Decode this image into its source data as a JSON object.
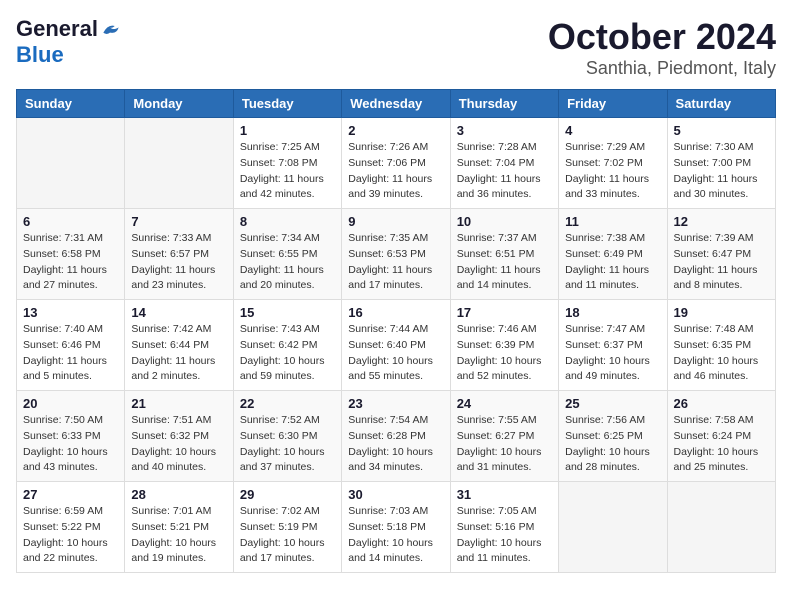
{
  "header": {
    "logo_general": "General",
    "logo_blue": "Blue",
    "month": "October 2024",
    "location": "Santhia, Piedmont, Italy"
  },
  "weekdays": [
    "Sunday",
    "Monday",
    "Tuesday",
    "Wednesday",
    "Thursday",
    "Friday",
    "Saturday"
  ],
  "weeks": [
    [
      {
        "day": "",
        "sunrise": "",
        "sunset": "",
        "daylight": ""
      },
      {
        "day": "",
        "sunrise": "",
        "sunset": "",
        "daylight": ""
      },
      {
        "day": "1",
        "sunrise": "Sunrise: 7:25 AM",
        "sunset": "Sunset: 7:08 PM",
        "daylight": "Daylight: 11 hours and 42 minutes."
      },
      {
        "day": "2",
        "sunrise": "Sunrise: 7:26 AM",
        "sunset": "Sunset: 7:06 PM",
        "daylight": "Daylight: 11 hours and 39 minutes."
      },
      {
        "day": "3",
        "sunrise": "Sunrise: 7:28 AM",
        "sunset": "Sunset: 7:04 PM",
        "daylight": "Daylight: 11 hours and 36 minutes."
      },
      {
        "day": "4",
        "sunrise": "Sunrise: 7:29 AM",
        "sunset": "Sunset: 7:02 PM",
        "daylight": "Daylight: 11 hours and 33 minutes."
      },
      {
        "day": "5",
        "sunrise": "Sunrise: 7:30 AM",
        "sunset": "Sunset: 7:00 PM",
        "daylight": "Daylight: 11 hours and 30 minutes."
      }
    ],
    [
      {
        "day": "6",
        "sunrise": "Sunrise: 7:31 AM",
        "sunset": "Sunset: 6:58 PM",
        "daylight": "Daylight: 11 hours and 27 minutes."
      },
      {
        "day": "7",
        "sunrise": "Sunrise: 7:33 AM",
        "sunset": "Sunset: 6:57 PM",
        "daylight": "Daylight: 11 hours and 23 minutes."
      },
      {
        "day": "8",
        "sunrise": "Sunrise: 7:34 AM",
        "sunset": "Sunset: 6:55 PM",
        "daylight": "Daylight: 11 hours and 20 minutes."
      },
      {
        "day": "9",
        "sunrise": "Sunrise: 7:35 AM",
        "sunset": "Sunset: 6:53 PM",
        "daylight": "Daylight: 11 hours and 17 minutes."
      },
      {
        "day": "10",
        "sunrise": "Sunrise: 7:37 AM",
        "sunset": "Sunset: 6:51 PM",
        "daylight": "Daylight: 11 hours and 14 minutes."
      },
      {
        "day": "11",
        "sunrise": "Sunrise: 7:38 AM",
        "sunset": "Sunset: 6:49 PM",
        "daylight": "Daylight: 11 hours and 11 minutes."
      },
      {
        "day": "12",
        "sunrise": "Sunrise: 7:39 AM",
        "sunset": "Sunset: 6:47 PM",
        "daylight": "Daylight: 11 hours and 8 minutes."
      }
    ],
    [
      {
        "day": "13",
        "sunrise": "Sunrise: 7:40 AM",
        "sunset": "Sunset: 6:46 PM",
        "daylight": "Daylight: 11 hours and 5 minutes."
      },
      {
        "day": "14",
        "sunrise": "Sunrise: 7:42 AM",
        "sunset": "Sunset: 6:44 PM",
        "daylight": "Daylight: 11 hours and 2 minutes."
      },
      {
        "day": "15",
        "sunrise": "Sunrise: 7:43 AM",
        "sunset": "Sunset: 6:42 PM",
        "daylight": "Daylight: 10 hours and 59 minutes."
      },
      {
        "day": "16",
        "sunrise": "Sunrise: 7:44 AM",
        "sunset": "Sunset: 6:40 PM",
        "daylight": "Daylight: 10 hours and 55 minutes."
      },
      {
        "day": "17",
        "sunrise": "Sunrise: 7:46 AM",
        "sunset": "Sunset: 6:39 PM",
        "daylight": "Daylight: 10 hours and 52 minutes."
      },
      {
        "day": "18",
        "sunrise": "Sunrise: 7:47 AM",
        "sunset": "Sunset: 6:37 PM",
        "daylight": "Daylight: 10 hours and 49 minutes."
      },
      {
        "day": "19",
        "sunrise": "Sunrise: 7:48 AM",
        "sunset": "Sunset: 6:35 PM",
        "daylight": "Daylight: 10 hours and 46 minutes."
      }
    ],
    [
      {
        "day": "20",
        "sunrise": "Sunrise: 7:50 AM",
        "sunset": "Sunset: 6:33 PM",
        "daylight": "Daylight: 10 hours and 43 minutes."
      },
      {
        "day": "21",
        "sunrise": "Sunrise: 7:51 AM",
        "sunset": "Sunset: 6:32 PM",
        "daylight": "Daylight: 10 hours and 40 minutes."
      },
      {
        "day": "22",
        "sunrise": "Sunrise: 7:52 AM",
        "sunset": "Sunset: 6:30 PM",
        "daylight": "Daylight: 10 hours and 37 minutes."
      },
      {
        "day": "23",
        "sunrise": "Sunrise: 7:54 AM",
        "sunset": "Sunset: 6:28 PM",
        "daylight": "Daylight: 10 hours and 34 minutes."
      },
      {
        "day": "24",
        "sunrise": "Sunrise: 7:55 AM",
        "sunset": "Sunset: 6:27 PM",
        "daylight": "Daylight: 10 hours and 31 minutes."
      },
      {
        "day": "25",
        "sunrise": "Sunrise: 7:56 AM",
        "sunset": "Sunset: 6:25 PM",
        "daylight": "Daylight: 10 hours and 28 minutes."
      },
      {
        "day": "26",
        "sunrise": "Sunrise: 7:58 AM",
        "sunset": "Sunset: 6:24 PM",
        "daylight": "Daylight: 10 hours and 25 minutes."
      }
    ],
    [
      {
        "day": "27",
        "sunrise": "Sunrise: 6:59 AM",
        "sunset": "Sunset: 5:22 PM",
        "daylight": "Daylight: 10 hours and 22 minutes."
      },
      {
        "day": "28",
        "sunrise": "Sunrise: 7:01 AM",
        "sunset": "Sunset: 5:21 PM",
        "daylight": "Daylight: 10 hours and 19 minutes."
      },
      {
        "day": "29",
        "sunrise": "Sunrise: 7:02 AM",
        "sunset": "Sunset: 5:19 PM",
        "daylight": "Daylight: 10 hours and 17 minutes."
      },
      {
        "day": "30",
        "sunrise": "Sunrise: 7:03 AM",
        "sunset": "Sunset: 5:18 PM",
        "daylight": "Daylight: 10 hours and 14 minutes."
      },
      {
        "day": "31",
        "sunrise": "Sunrise: 7:05 AM",
        "sunset": "Sunset: 5:16 PM",
        "daylight": "Daylight: 10 hours and 11 minutes."
      },
      {
        "day": "",
        "sunrise": "",
        "sunset": "",
        "daylight": ""
      },
      {
        "day": "",
        "sunrise": "",
        "sunset": "",
        "daylight": ""
      }
    ]
  ]
}
